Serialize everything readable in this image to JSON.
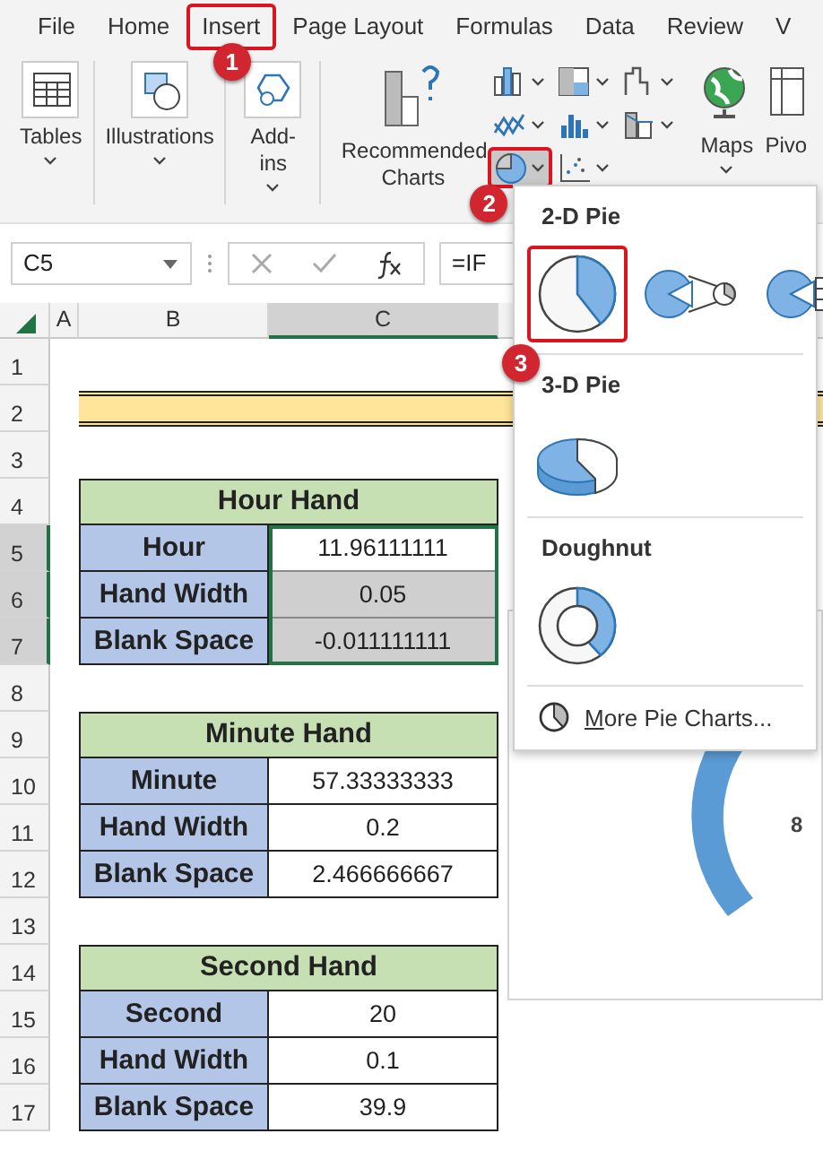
{
  "menu_tabs": [
    {
      "label": "File",
      "highlighted": false
    },
    {
      "label": "Home",
      "highlighted": false
    },
    {
      "label": "Insert",
      "highlighted": true,
      "callout": "1"
    },
    {
      "label": "Page Layout",
      "highlighted": false
    },
    {
      "label": "Formulas",
      "highlighted": false
    },
    {
      "label": "Data",
      "highlighted": false
    },
    {
      "label": "Review",
      "highlighted": false
    },
    {
      "label": "V",
      "highlighted": false
    }
  ],
  "ribbon_groups": [
    {
      "label": "Tables",
      "kind": "table"
    },
    {
      "label": "Illustrations",
      "kind": "shapes"
    },
    {
      "label": "Add-ins",
      "kind": "addin"
    },
    {
      "label": "Recommended Charts",
      "kind": "recommended"
    }
  ],
  "chart_buttons": [
    {
      "kind": "column",
      "highlighted": false
    },
    {
      "kind": "hierarchy",
      "highlighted": false
    },
    {
      "kind": "waterfall",
      "highlighted": false
    },
    {
      "kind": "line",
      "highlighted": false
    },
    {
      "kind": "statistic",
      "highlighted": false
    },
    {
      "kind": "combo",
      "highlighted": false
    },
    {
      "kind": "pie",
      "highlighted": true,
      "callout": "2"
    },
    {
      "kind": "scatter",
      "highlighted": false
    }
  ],
  "ribbon_extra": [
    {
      "label": "Maps",
      "kind": "globe"
    },
    {
      "label": "Pivo",
      "kind": "pivot"
    }
  ],
  "formula_bar": {
    "name_box": "C5",
    "formula": "=IF"
  },
  "column_headers": [
    {
      "label": "A",
      "selected": false
    },
    {
      "label": "B",
      "selected": false
    },
    {
      "label": "C",
      "selected": true
    }
  ],
  "row_headers": [
    {
      "label": "1",
      "selected": false
    },
    {
      "label": "2",
      "selected": false
    },
    {
      "label": "3",
      "selected": false
    },
    {
      "label": "4",
      "selected": false
    },
    {
      "label": "5",
      "selected": true
    },
    {
      "label": "6",
      "selected": true
    },
    {
      "label": "7",
      "selected": true
    },
    {
      "label": "8",
      "selected": false
    },
    {
      "label": "9",
      "selected": false
    },
    {
      "label": "10",
      "selected": false
    },
    {
      "label": "11",
      "selected": false
    },
    {
      "label": "12",
      "selected": false
    },
    {
      "label": "13",
      "selected": false
    },
    {
      "label": "14",
      "selected": false
    },
    {
      "label": "15",
      "selected": false
    },
    {
      "label": "16",
      "selected": false
    },
    {
      "label": "17",
      "selected": false
    }
  ],
  "tables": [
    {
      "title": "Hour Hand",
      "rows": [
        {
          "label": "Hour",
          "value": "11.96111111",
          "selected": true
        },
        {
          "label": "Hand Width",
          "value": "0.05",
          "selected": true
        },
        {
          "label": "Blank Space",
          "value": "-0.011111111",
          "selected": true
        }
      ]
    },
    {
      "title": "Minute Hand",
      "rows": [
        {
          "label": "Minute",
          "value": "57.33333333",
          "selected": false
        },
        {
          "label": "Hand Width",
          "value": "0.2",
          "selected": false
        },
        {
          "label": "Blank Space",
          "value": "2.466666667",
          "selected": false
        }
      ]
    },
    {
      "title": "Second Hand",
      "rows": [
        {
          "label": "Second",
          "value": "20",
          "selected": false
        },
        {
          "label": "Hand Width",
          "value": "0.1",
          "selected": false
        },
        {
          "label": "Blank Space",
          "value": "39.9",
          "selected": false
        }
      ]
    }
  ],
  "dropdown": {
    "sections": [
      {
        "title": "2-D Pie",
        "options": [
          {
            "kind": "pie",
            "highlighted": true,
            "callout": "3"
          },
          {
            "kind": "pie-of-pie",
            "highlighted": false
          },
          {
            "kind": "bar-of-pie",
            "highlighted": false
          }
        ]
      },
      {
        "title": "3-D Pie",
        "options": [
          {
            "kind": "pie-3d",
            "highlighted": false
          }
        ]
      },
      {
        "title": "Doughnut",
        "options": [
          {
            "kind": "doughnut",
            "highlighted": false
          }
        ]
      }
    ],
    "more": "More Pie Charts..."
  },
  "chart_label": "8"
}
